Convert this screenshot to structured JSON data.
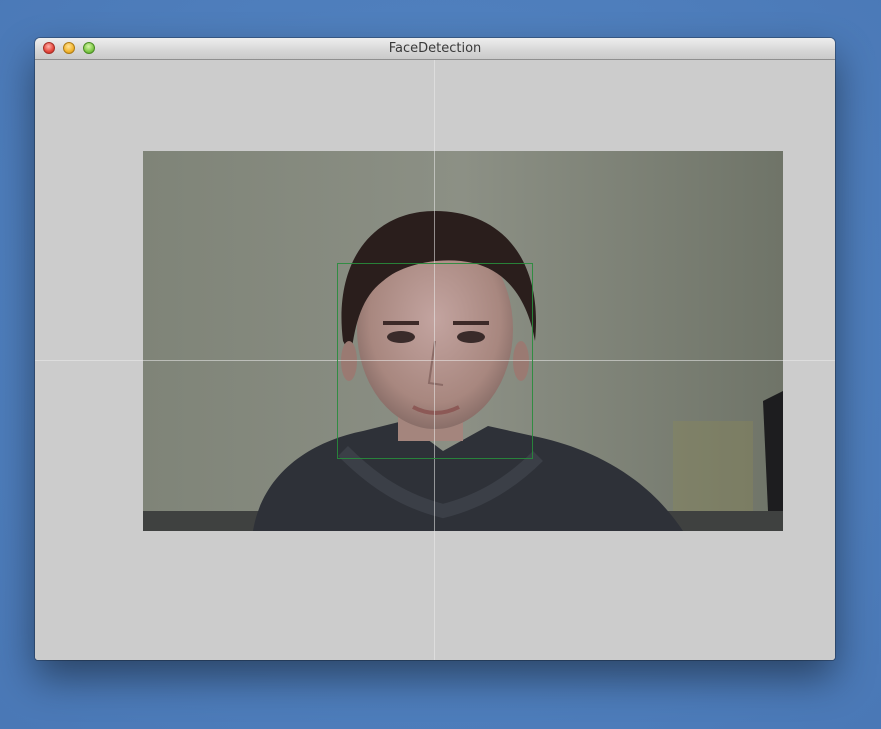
{
  "window": {
    "title": "FaceDetection"
  },
  "icons": {
    "close": "close-button",
    "minimize": "minimize-button",
    "zoom": "zoom-button"
  },
  "colors": {
    "desktop": "#4f7fbd",
    "canvas": "#cccccc",
    "face_box": "#2a8c3c",
    "crosshair": "#e6e6e6"
  }
}
